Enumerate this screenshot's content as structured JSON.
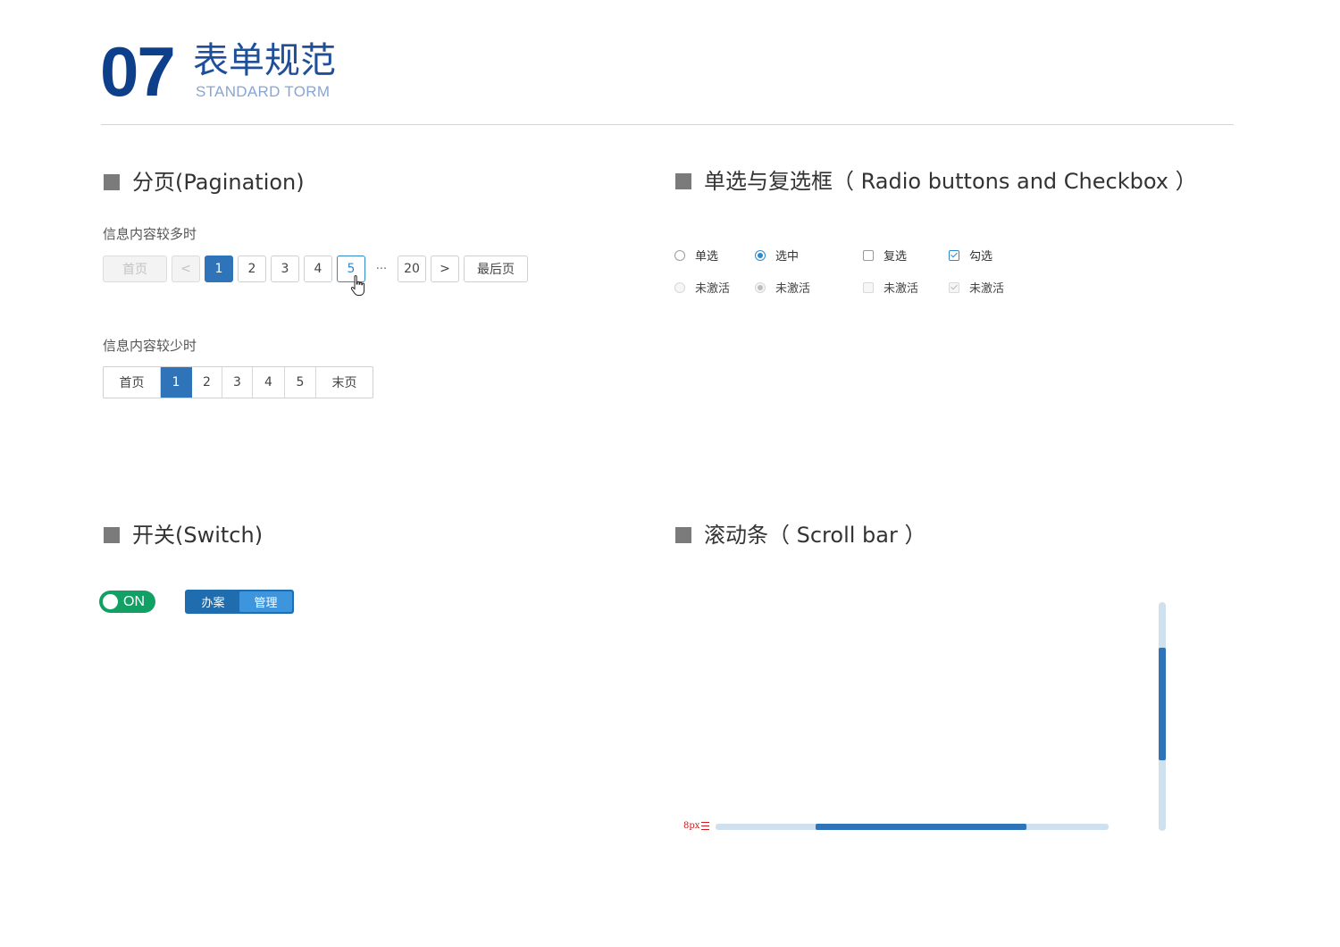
{
  "header": {
    "number": "07",
    "title": "表单规范",
    "subtitle": "STANDARD TORM"
  },
  "pagination": {
    "title": "分页(Pagination)",
    "many": {
      "label": "信息内容较多时",
      "first": "首页",
      "prev": "<",
      "pages": [
        "1",
        "2",
        "3",
        "4",
        "5"
      ],
      "active_page": "1",
      "hover_page": "5",
      "ellipsis": "···",
      "last_page_num": "20",
      "next": ">",
      "last": "最后页"
    },
    "few": {
      "label": "信息内容较少时",
      "first": "首页",
      "pages": [
        "1",
        "2",
        "3",
        "4",
        "5"
      ],
      "active_page": "1",
      "last": "末页"
    }
  },
  "choices": {
    "title": "单选与复选框（ Radio buttons and Checkbox ）",
    "radio_unchecked": "单选",
    "radio_checked": "选中",
    "checkbox_unchecked": "复选",
    "checkbox_checked": "勾选",
    "disabled_radio_unchecked": "未激活",
    "disabled_radio_checked": "未激活",
    "disabled_checkbox_unchecked": "未激活",
    "disabled_checkbox_checked": "未激活"
  },
  "switch": {
    "title": "开关(Switch)",
    "toggle_label": "ON",
    "toggle_on": true,
    "segment_options": [
      "办案",
      "管理"
    ],
    "segment_active": "管理"
  },
  "scrollbar": {
    "title": "滚动条（ Scroll bar ）",
    "dimension_note": "8px",
    "vertical_thumb_start": 0.2,
    "vertical_thumb_end": 0.69,
    "horizontal_thumb_start": 0.255,
    "horizontal_thumb_end": 0.79
  },
  "colors": {
    "primary": "#2f74b8",
    "header_blue": "#0e3f8a",
    "switch_green": "#13a064",
    "scroll_track": "#cfe0ee",
    "annotation_red": "#d21a1a"
  },
  "icons": [
    "hand-pointer-icon",
    "check-icon"
  ]
}
